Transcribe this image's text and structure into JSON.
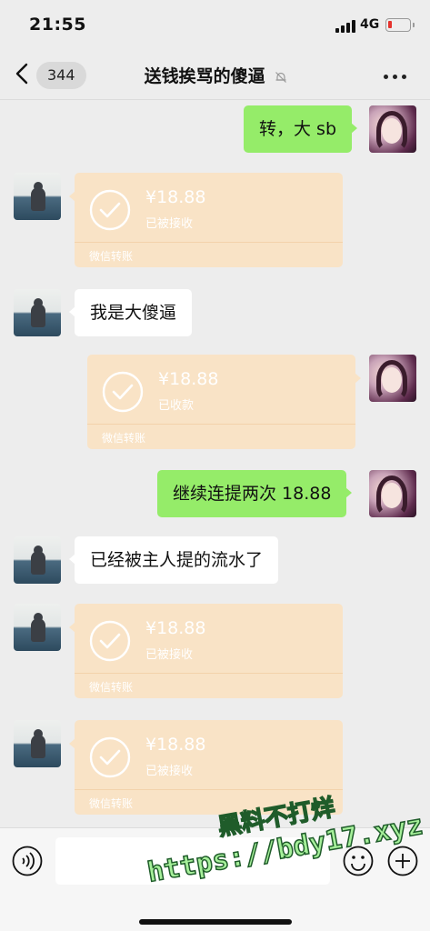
{
  "status_bar": {
    "time": "21:55",
    "network": "4G"
  },
  "nav": {
    "unread_count": "344",
    "title": "送钱挨骂的傻逼"
  },
  "messages": [
    {
      "type": "text",
      "side": "right",
      "text": "转，大 sb"
    },
    {
      "type": "transfer",
      "side": "left",
      "amount": "¥18.88",
      "status": "已被接收",
      "footer": "微信转账"
    },
    {
      "type": "text",
      "side": "left",
      "text": "我是大傻逼"
    },
    {
      "type": "transfer",
      "side": "right",
      "amount": "¥18.88",
      "status": "已收款",
      "footer": "微信转账"
    },
    {
      "type": "text",
      "side": "right",
      "text": "继续连提两次 18.88"
    },
    {
      "type": "text",
      "side": "left",
      "text": "已经被主人提的流水了"
    },
    {
      "type": "transfer",
      "side": "left",
      "amount": "¥18.88",
      "status": "已被接收",
      "footer": "微信转账"
    },
    {
      "type": "transfer",
      "side": "left",
      "amount": "¥18.88",
      "status": "已被接收",
      "footer": "微信转账"
    }
  ],
  "input_bar": {
    "placeholder": ""
  },
  "watermark": {
    "line1": "黑料不打烊",
    "line2": "https://bdy17.xyz"
  },
  "colors": {
    "background": "#ededed",
    "my_bubble": "#95ec69",
    "their_bubble": "#ffffff",
    "transfer_card": "#f9e3c6"
  },
  "icons": [
    "back-chevron-icon",
    "mute-bell-icon",
    "more-dots-icon",
    "voice-icon",
    "emoji-icon",
    "plus-icon",
    "check-circle-icon"
  ]
}
